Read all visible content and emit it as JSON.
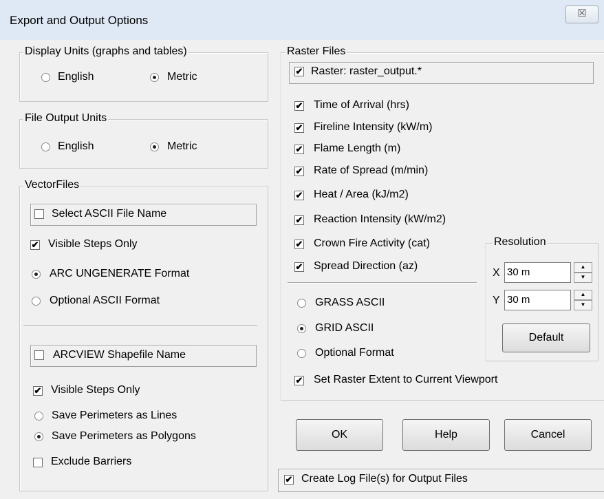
{
  "window": {
    "title": "Export and Output Options",
    "close_glyph": "☒"
  },
  "display_units": {
    "legend": "Display Units (graphs and tables)",
    "english": "English",
    "metric": "Metric",
    "selected": "Metric"
  },
  "file_output_units": {
    "legend": "File Output Units",
    "english": "English",
    "metric": "Metric",
    "selected": "Metric"
  },
  "vector_files": {
    "legend": "VectorFiles",
    "select_ascii": "Select ASCII File Name",
    "visible_steps_1": "Visible Steps Only",
    "arc_ungenerate": "ARC UNGENERATE Format",
    "optional_ascii": "Optional ASCII Format",
    "arcview_shapefile": "ARCVIEW Shapefile Name",
    "visible_steps_2": "Visible Steps Only",
    "save_lines": "Save Perimeters as Lines",
    "save_polygons": "Save Perimeters as Polygons",
    "exclude_barriers": "Exclude Barriers"
  },
  "raster_files": {
    "legend": "Raster Files",
    "raster": "Raster: raster_output.*",
    "items": [
      "Time of Arrival (hrs)",
      "Fireline Intensity (kW/m)",
      "Flame Length (m)",
      "Rate of Spread (m/min)",
      "Heat / Area (kJ/m2)",
      "Reaction Intensity (kW/m2)",
      "Crown Fire Activity (cat)",
      "Spread Direction (az)"
    ],
    "grass_ascii": "GRASS ASCII",
    "grid_ascii": "GRID ASCII",
    "optional_format": "Optional Format",
    "set_extent": "Set Raster Extent to Current Viewport"
  },
  "resolution": {
    "legend": "Resolution",
    "x_label": "X",
    "x_value": "30 m",
    "y_label": "Y",
    "y_value": "30 m",
    "default_label": "Default"
  },
  "buttons": {
    "ok": "OK",
    "help": "Help",
    "cancel": "Cancel"
  },
  "log_file": "Create Log File(s) for Output Files",
  "glyphs": {
    "check": "✔",
    "up": "▲",
    "down": "▼"
  }
}
